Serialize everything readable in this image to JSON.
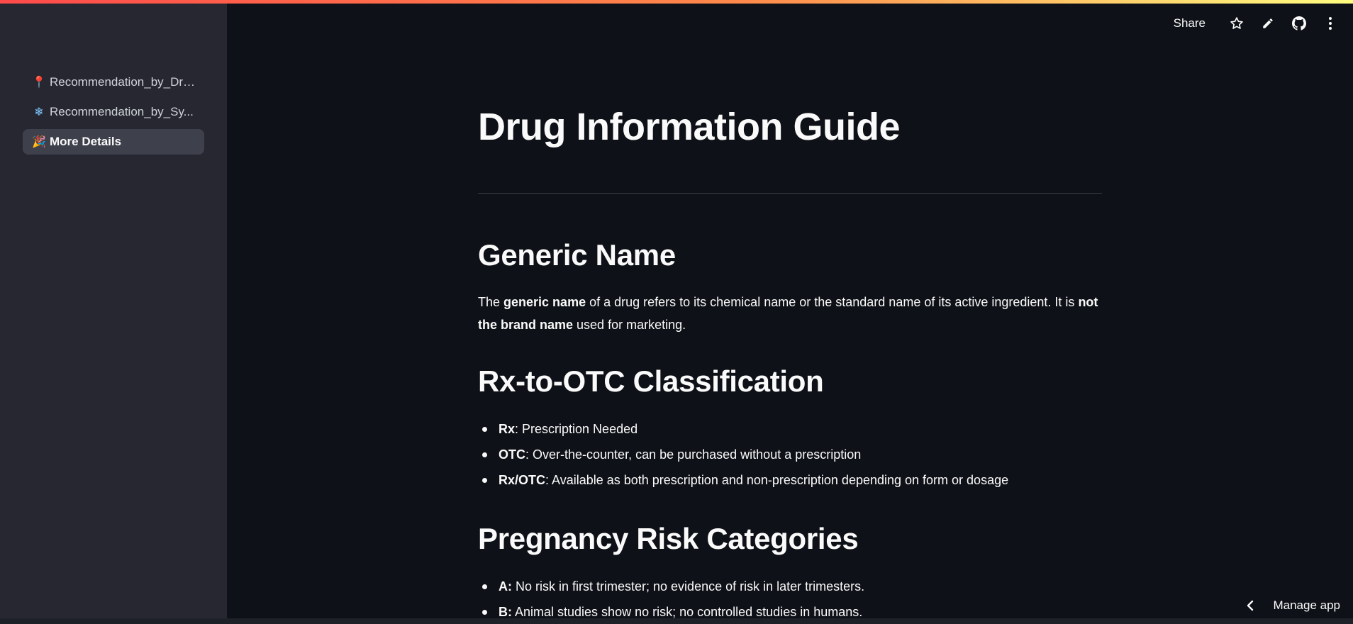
{
  "sidebar": {
    "items": [
      {
        "emoji": "📍",
        "label": "Recommendation_by_Drug",
        "active": false
      },
      {
        "emoji": "❄",
        "label": "Recommendation_by_Sy...",
        "active": false
      },
      {
        "emoji": "🎉",
        "label": "More Details",
        "active": true
      }
    ]
  },
  "toolbar": {
    "share_label": "Share",
    "icons": [
      "star-icon",
      "pencil-icon",
      "github-icon",
      "kebab-menu-icon"
    ]
  },
  "main": {
    "title": "Drug Information Guide",
    "sections": [
      {
        "heading": "Generic Name",
        "paragraph": {
          "t1": "The ",
          "b1": "generic name",
          "t2": " of a drug refers to its chemical name or the standard name of its active ingredient. It is ",
          "b2": "not the brand name",
          "t3": " used for marketing."
        }
      },
      {
        "heading": "Rx-to-OTC Classification",
        "items": [
          {
            "term": "Rx",
            "text": ": Prescription Needed"
          },
          {
            "term": "OTC",
            "text": ": Over-the-counter, can be purchased without a prescription"
          },
          {
            "term": "Rx/OTC",
            "text": ": Available as both prescription and non-prescription depending on form or dosage"
          }
        ]
      },
      {
        "heading": "Pregnancy Risk Categories",
        "items": [
          {
            "term": "A:",
            "text": " No risk in first trimester; no evidence of risk in later trimesters."
          },
          {
            "term": "B:",
            "text": " Animal studies show no risk; no controlled studies in humans."
          }
        ]
      }
    ]
  },
  "footer": {
    "manage_label": "Manage app"
  },
  "colors": {
    "background": "#0e1117",
    "sidebar": "#262730",
    "active_item": "#3e404c",
    "text": "#fafafa",
    "accent_red": "#ff4b4b"
  }
}
